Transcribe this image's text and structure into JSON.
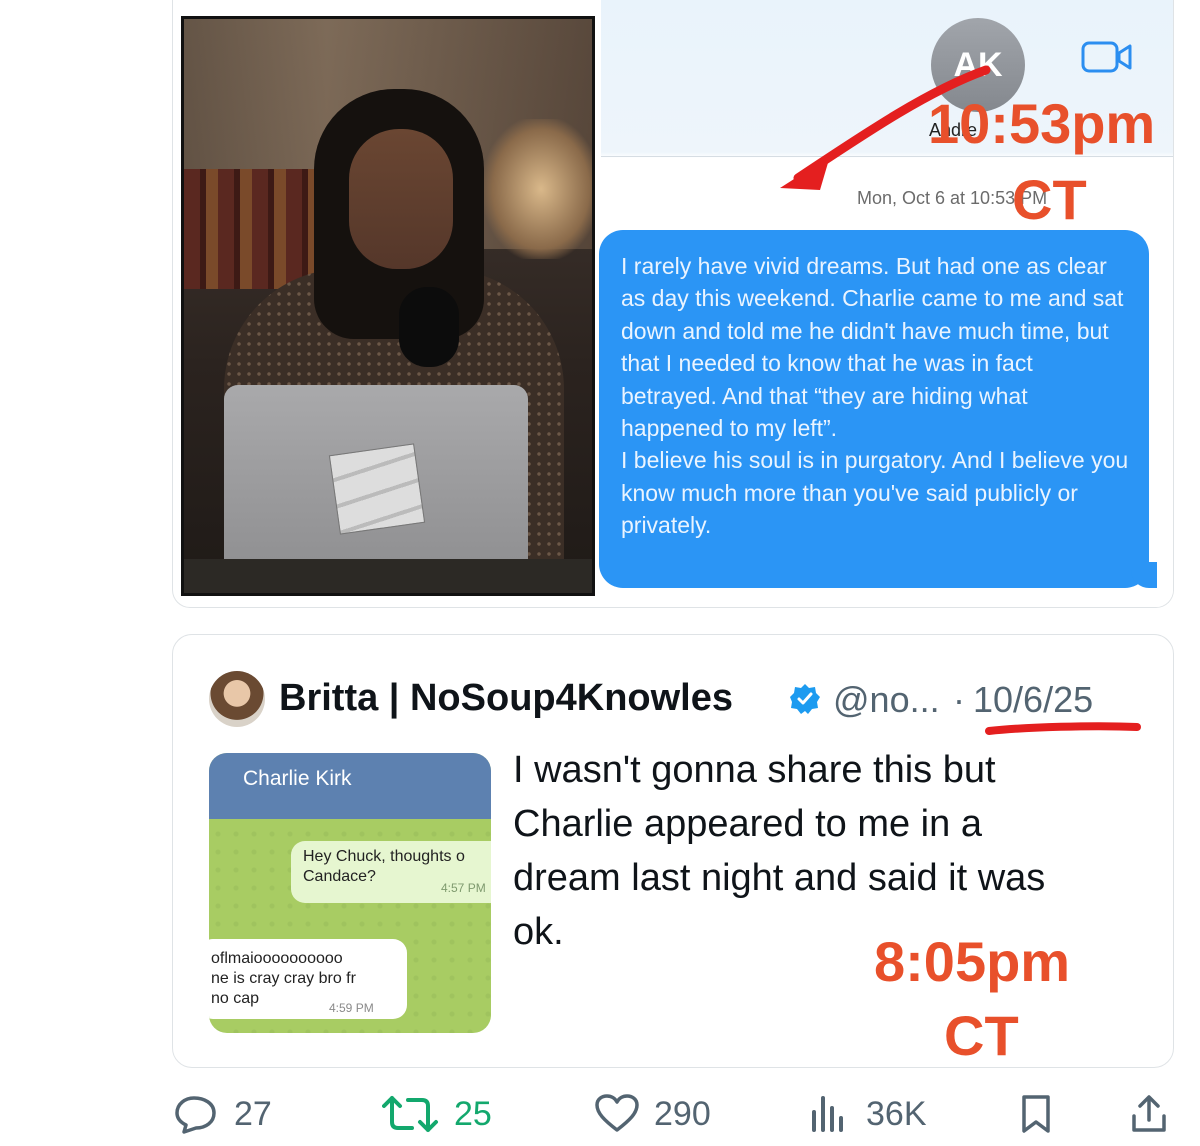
{
  "quoted_image": {
    "contact": {
      "initials": "AK",
      "name": "Andre"
    },
    "timestamp": "Mon, Oct 6 at 10:53 PM",
    "message": "I rarely have vivid dreams. But had one as clear as day this weekend. Charlie came to me and sat down and told me he didn't have much time, but that I needed to know that he was in fact betrayed. And that “they are hiding what happened to my left”.\nI believe his soul is in purgatory. And I believe you know much more than you've said publicly or privately.",
    "annotation_time": "10:53pm",
    "annotation_zone": "CT",
    "annotation_color": "#e8502b"
  },
  "tweet": {
    "display_name": "Britta | NoSoup4Knowles",
    "handle": "@no...",
    "separator": "·",
    "date": "10/6/25",
    "text": "I wasn't gonna share this but\nCharlie appeared to me in a\ndream last night and said it was\nok.",
    "media": {
      "chat_title": "Charlie Kirk",
      "sent_message": "Hey Chuck, thoughts o\nCandace?",
      "sent_time": "4:57 PM",
      "reply_message": "oflmaioooooooooo\nne is cray cray bro fr\n no cap",
      "reply_time": "4:59 PM"
    },
    "annotation_time": "8:05pm",
    "annotation_zone": "CT"
  },
  "actions": {
    "replies": "27",
    "reposts": "25",
    "likes": "290",
    "views": "36K"
  }
}
